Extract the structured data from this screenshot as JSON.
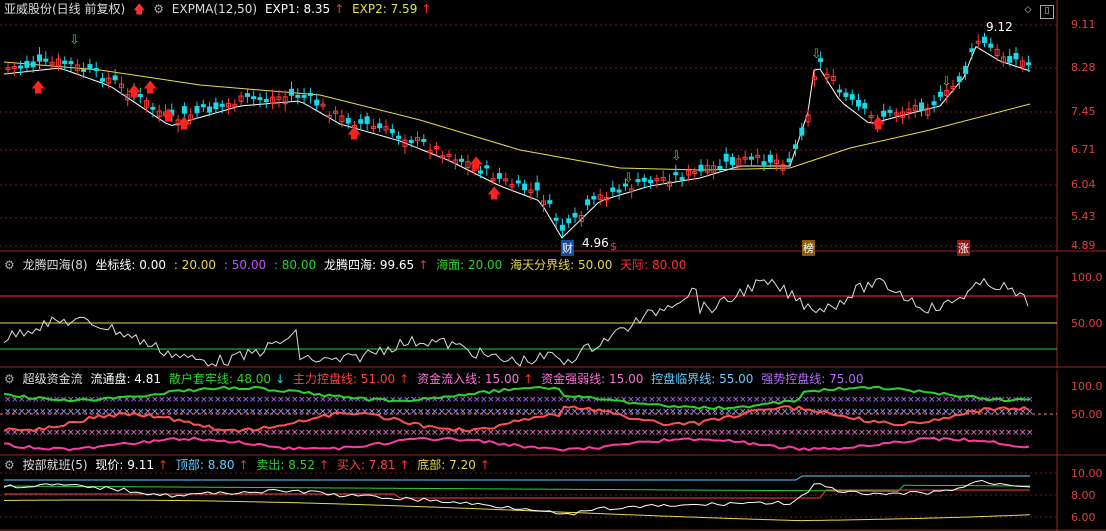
{
  "colors": {
    "up": "#ff3b3b",
    "down": "#1ad9e6",
    "ma1": "#ffffff",
    "ma2": "#e6e04a",
    "grid": "#7a1a1a",
    "purple": "#b86bff",
    "pink": "#ff6fd6",
    "green": "#2bd42b",
    "red": "#ff4040",
    "cyan": "#66ccff",
    "yellow": "#e6d84a"
  },
  "main": {
    "stock": "亚威股份(日线 前复权)",
    "indicator": "EXPMA(12,50)",
    "exp1_label": "EXP1: 8.35",
    "exp2_label": "EXP2: 7.59",
    "axis_ticks": [
      "9.11",
      "8.28",
      "7.45",
      "6.71",
      "6.04",
      "5.43",
      "4.89"
    ],
    "high_label": "9.12",
    "low_label": "4.96",
    "markers": [
      "财",
      "$",
      "榜",
      "涨"
    ]
  },
  "p2": {
    "title": "龙腾四海(8)",
    "coord_label": "坐标线: 0.00",
    "v20": ": 20.00",
    "v50": ": 50.00",
    "v80": ": 80.00",
    "main_label": "龙腾四海: 99.65",
    "sea": "海面: 20.00",
    "boundary": "海天分界线: 50.00",
    "sky": "天际: 80.00",
    "axis_ticks": [
      "100.0",
      "50.00"
    ]
  },
  "p3": {
    "title": "超级资金流",
    "float": "流通盘: 4.81",
    "retail": "散户套牢线: 48.00",
    "main_ctrl": "主力控盘线: 51.00",
    "inflow": "资金流入线: 15.00",
    "strength": "资金强弱线: 15.00",
    "critical": "控盘临界线: 55.00",
    "strong": "强势控盘线: 75.00",
    "axis_ticks": [
      "100.0",
      "50.00"
    ]
  },
  "p4": {
    "title": "按部就班(5)",
    "price": "现价: 9.11",
    "top": "顶部: 8.80",
    "sell": "卖出: 8.52",
    "buy": "买入: 7.81",
    "bottom": "底部: 7.20",
    "axis_ticks": [
      "10.00",
      "8.00",
      "6.00"
    ]
  }
}
